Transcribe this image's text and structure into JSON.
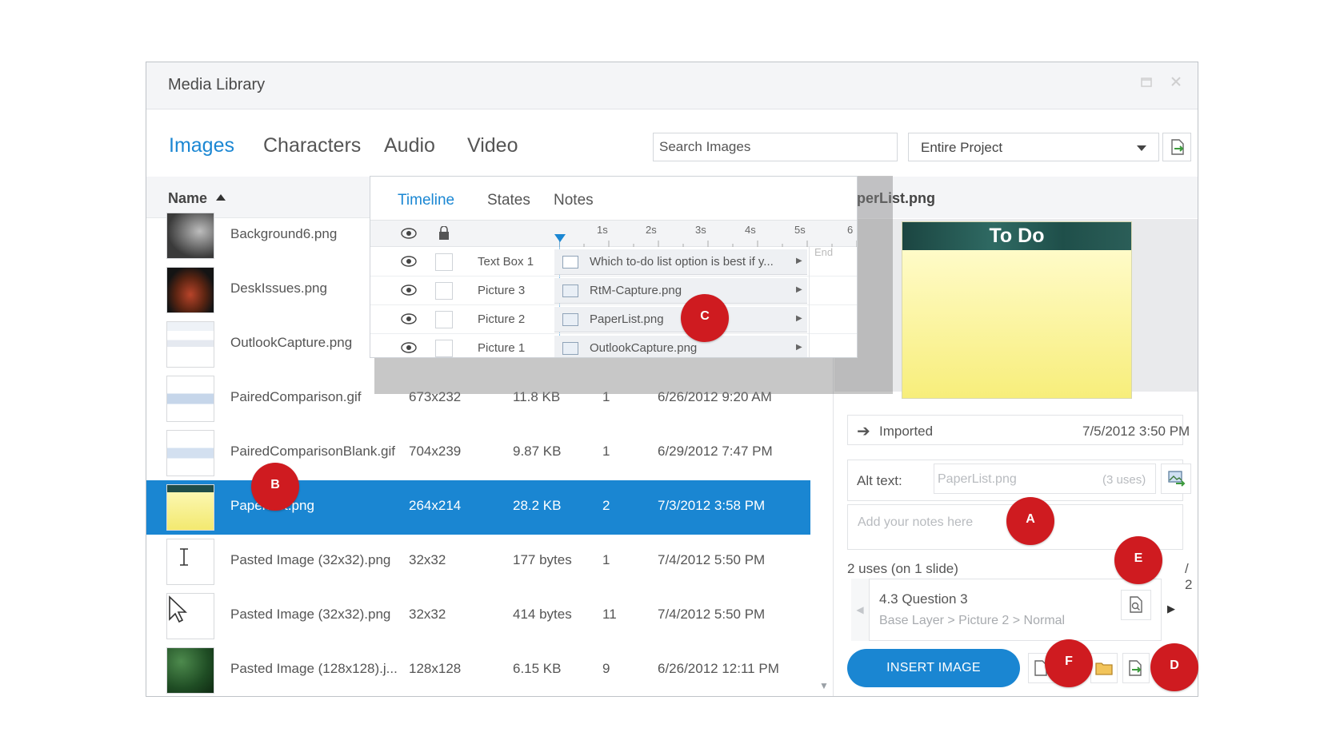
{
  "window": {
    "title": "Media Library",
    "maximize_icon": "maximize-icon",
    "close_icon": "close-icon"
  },
  "tabs": [
    {
      "label": "Images",
      "active": true
    },
    {
      "label": "Characters",
      "active": false
    },
    {
      "label": "Audio",
      "active": false
    },
    {
      "label": "Video",
      "active": false
    }
  ],
  "search": {
    "placeholder": "Search Images",
    "value": ""
  },
  "scope": {
    "selected": "Entire Project"
  },
  "list": {
    "column_name": "Name",
    "sort": "ascending",
    "rows": [
      {
        "name": "Background6.png",
        "dims": "",
        "size": "",
        "uses": "",
        "date": ""
      },
      {
        "name": "DeskIssues.png",
        "dims": "",
        "size": "",
        "uses": "",
        "date": ""
      },
      {
        "name": "OutlookCapture.png",
        "dims": "",
        "size": "",
        "uses": "",
        "date": ""
      },
      {
        "name": "PairedComparison.gif",
        "dims": "673x232",
        "size": "11.8 KB",
        "uses": "1",
        "date": "6/26/2012 9:20 AM"
      },
      {
        "name": "PairedComparisonBlank.gif",
        "dims": "704x239",
        "size": "9.87 KB",
        "uses": "1",
        "date": "6/29/2012 7:47 PM"
      },
      {
        "name": "PaperList.png",
        "dims": "264x214",
        "size": "28.2 KB",
        "uses": "2",
        "date": "7/3/2012 3:58 PM",
        "selected": true
      },
      {
        "name": "Pasted Image (32x32).png",
        "dims": "32x32",
        "size": "177 bytes",
        "uses": "1",
        "date": "7/4/2012 5:50 PM"
      },
      {
        "name": "Pasted Image (32x32).png",
        "dims": "32x32",
        "size": "414 bytes",
        "uses": "11",
        "date": "7/4/2012 5:50 PM"
      },
      {
        "name": "Pasted Image (128x128).j...",
        "dims": "128x128",
        "size": "6.15 KB",
        "uses": "9",
        "date": "6/26/2012 12:11 PM"
      }
    ]
  },
  "preview": {
    "header_name": "aperList.png",
    "image_title": "To Do",
    "imported_label": "Imported",
    "imported_date": "7/5/2012 3:50 PM",
    "alt_label": "Alt text:",
    "alt_value": "PaperList.png",
    "alt_uses": "(3 uses)",
    "notes_placeholder": "Add your notes here",
    "uses_label": "2 uses (on 1 slide)",
    "uses_count": "/ 2",
    "slide_title": "4.3 Question 3",
    "slide_path": "Base Layer > Picture 2 > Normal",
    "insert_label": "INSERT IMAGE"
  },
  "timeline": {
    "tabs": [
      {
        "label": "Timeline",
        "active": true
      },
      {
        "label": "States",
        "active": false
      },
      {
        "label": "Notes",
        "active": false
      }
    ],
    "ticks": [
      "1s",
      "2s",
      "3s",
      "4s",
      "5s",
      "6"
    ],
    "end_label": "End",
    "rows": [
      {
        "label": "Text Box 1",
        "bar": "Which to-do list option is best if y...",
        "kind": "text"
      },
      {
        "label": "Picture 3",
        "bar": "RtM-Capture.png",
        "kind": "image"
      },
      {
        "label": "Picture 2",
        "bar": "PaperList.png",
        "kind": "image"
      },
      {
        "label": "Picture 1",
        "bar": "OutlookCapture.png",
        "kind": "image"
      }
    ]
  },
  "markers": {
    "a": "A",
    "b": "B",
    "c": "C",
    "d": "D",
    "e": "E",
    "f": "F"
  },
  "colors": {
    "accent": "#1a86d2",
    "marker": "#cf1b20"
  }
}
